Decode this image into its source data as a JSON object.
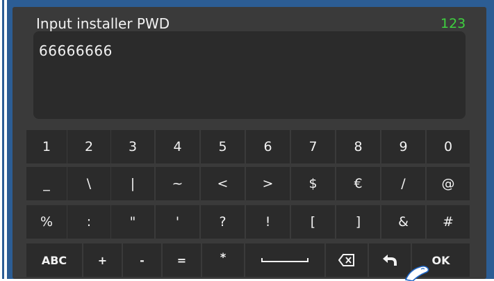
{
  "header": {
    "prompt": "Input installer PWD",
    "mode": "123"
  },
  "password": {
    "value": "66666666"
  },
  "keyboard": {
    "row1": [
      "1",
      "2",
      "3",
      "4",
      "5",
      "6",
      "7",
      "8",
      "9",
      "0"
    ],
    "row2": [
      "_",
      "\\",
      "|",
      "~",
      "<",
      ">",
      "$",
      "€",
      "/",
      "@"
    ],
    "row3": [
      "%",
      ":",
      "\"",
      "'",
      "?",
      "!",
      "[",
      "]",
      "&",
      "#"
    ],
    "row4": {
      "abc": "ABC",
      "plus": "+",
      "minus": "-",
      "equals": "=",
      "star": "*",
      "ok": "OK"
    }
  },
  "icons": {
    "space": "space-icon",
    "backspace": "backspace-icon",
    "back": "return-arrow-icon"
  },
  "colors": {
    "frame": "#2c5d94",
    "panel": "#3a3a3a",
    "key": "#2b2b2b",
    "mode_text": "#3fd13f",
    "text": "#f2f2f2"
  }
}
